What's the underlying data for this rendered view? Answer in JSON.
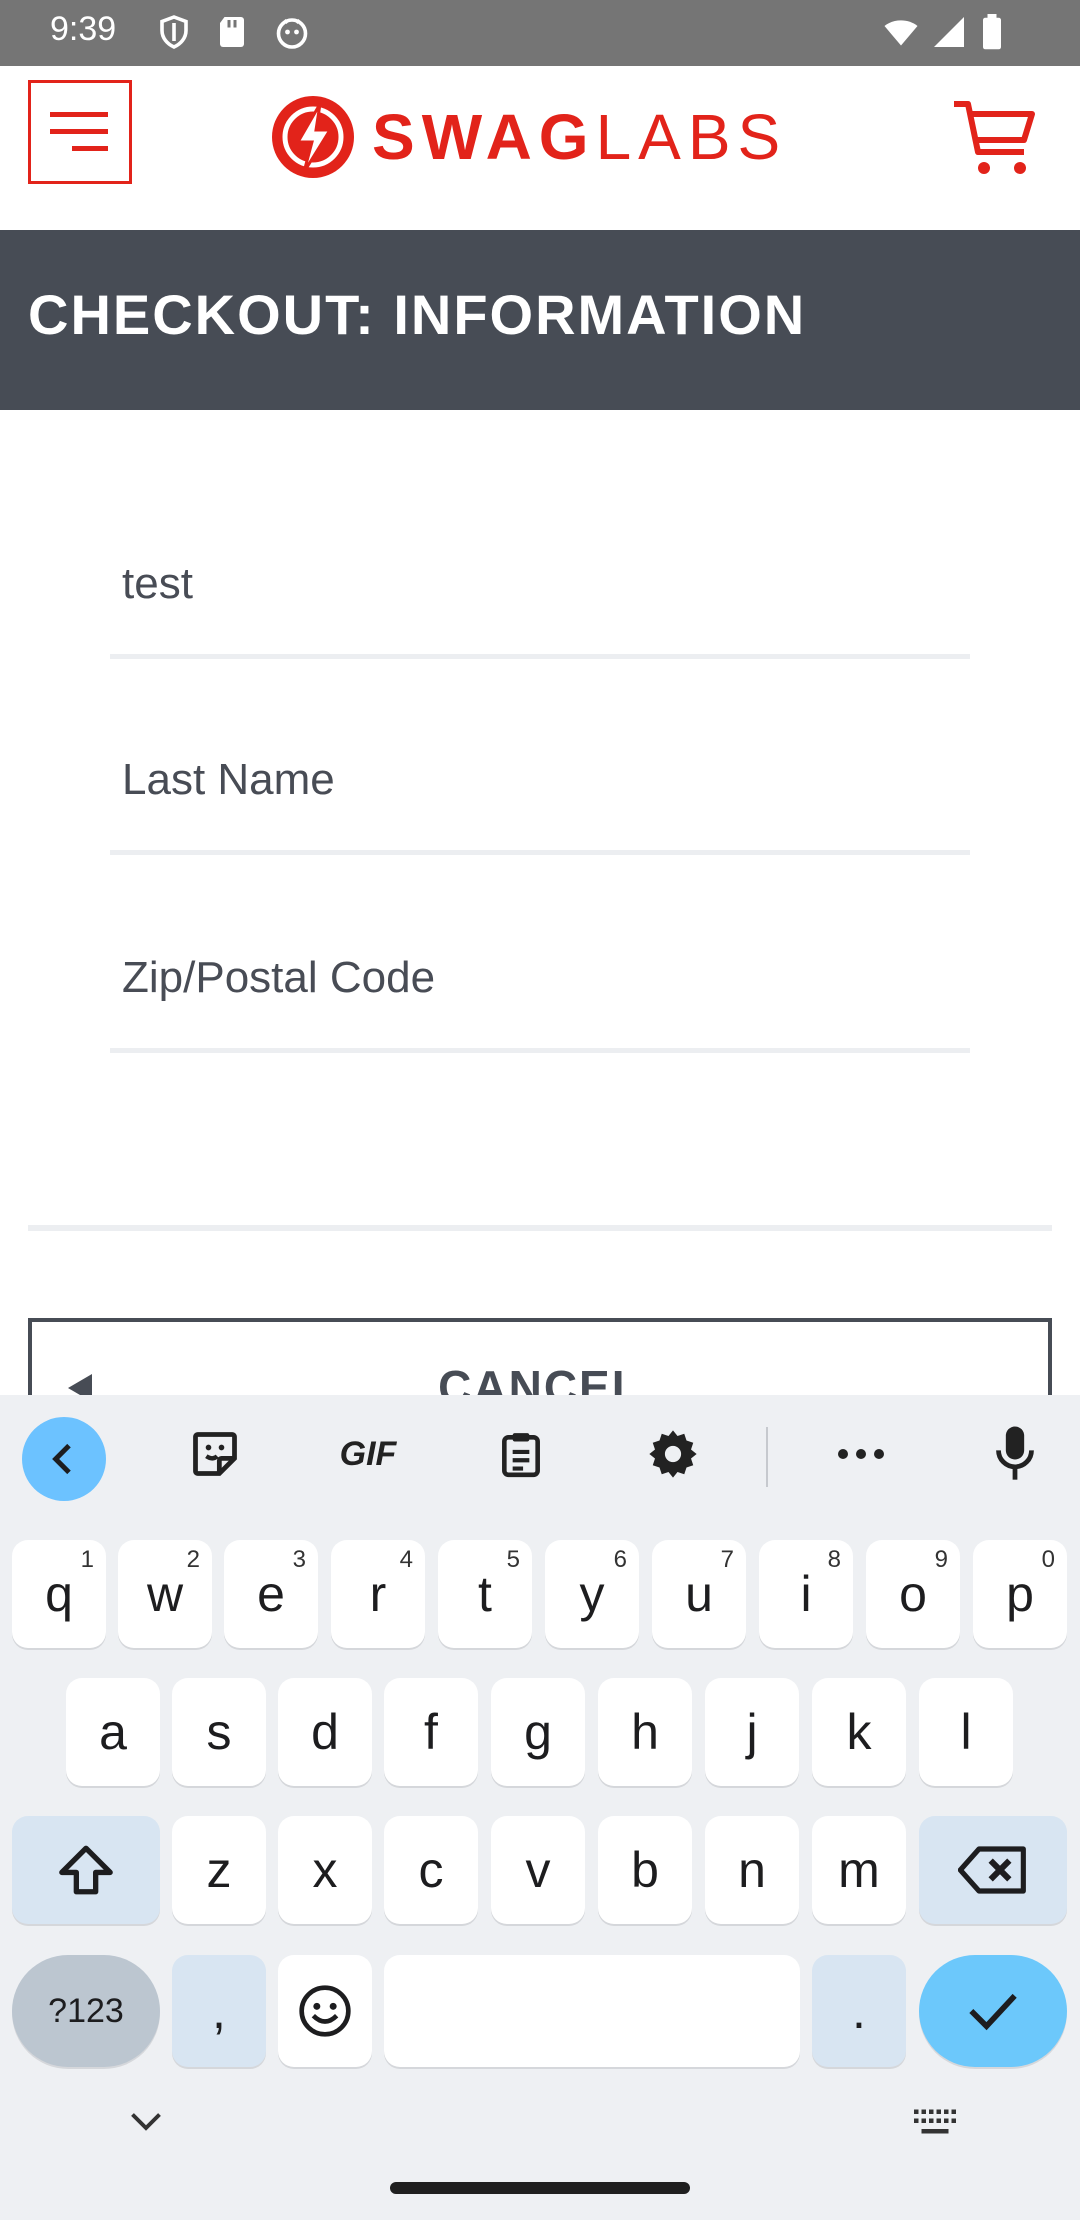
{
  "status_bar": {
    "time": "9:39"
  },
  "header": {
    "brand_bold": "SWAG",
    "brand_light": "LABS",
    "accent_color": "#e2231a",
    "menu_icon": "hamburger-menu-icon",
    "cart_icon": "shopping-cart-icon"
  },
  "page": {
    "title": "CHECKOUT: INFORMATION"
  },
  "form": {
    "first_name_value": "test",
    "last_name_placeholder": "Last Name",
    "zip_placeholder": "Zip/Postal Code"
  },
  "buttons": {
    "cancel_label": "CANCEL"
  },
  "keyboard": {
    "toolbar": [
      "back-chevron-icon",
      "sticker-icon",
      "gif-icon",
      "clipboard-icon",
      "settings-gear-icon",
      "more-dots-icon",
      "microphone-icon"
    ],
    "gif_label": "GIF",
    "row1": [
      {
        "k": "q",
        "s": "1"
      },
      {
        "k": "w",
        "s": "2"
      },
      {
        "k": "e",
        "s": "3"
      },
      {
        "k": "r",
        "s": "4"
      },
      {
        "k": "t",
        "s": "5"
      },
      {
        "k": "y",
        "s": "6"
      },
      {
        "k": "u",
        "s": "7"
      },
      {
        "k": "i",
        "s": "8"
      },
      {
        "k": "o",
        "s": "9"
      },
      {
        "k": "p",
        "s": "0"
      }
    ],
    "row2": [
      "a",
      "s",
      "d",
      "f",
      "g",
      "h",
      "j",
      "k",
      "l"
    ],
    "row3": [
      "z",
      "x",
      "c",
      "v",
      "b",
      "n",
      "m"
    ],
    "symbols_label": "?123",
    "comma_label": ",",
    "period_label": ".",
    "accent_color": "#6cc8fb"
  }
}
